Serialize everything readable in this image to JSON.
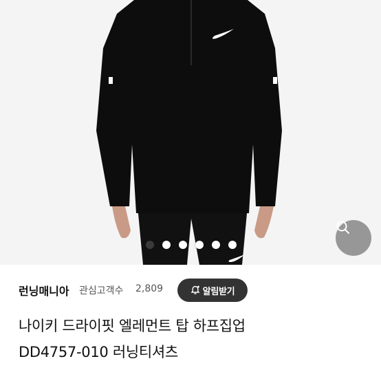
{
  "photo": {
    "dot_count": 6,
    "active_dot": 0,
    "zoom_icon": "search-icon"
  },
  "seller": {
    "name": "런닝매니아",
    "fans_label": "관심고객수",
    "fans_count": "2,809",
    "alarm_label": "알림받기",
    "alarm_icon": "bell-plus-icon"
  },
  "product": {
    "title_line1": "나이키 드라이핏 엘레먼트 탑 하프집업",
    "title_line2": "DD4757-010 러닝티셔츠"
  },
  "colors": {
    "accent": "#333333",
    "background": "#ffffff"
  }
}
